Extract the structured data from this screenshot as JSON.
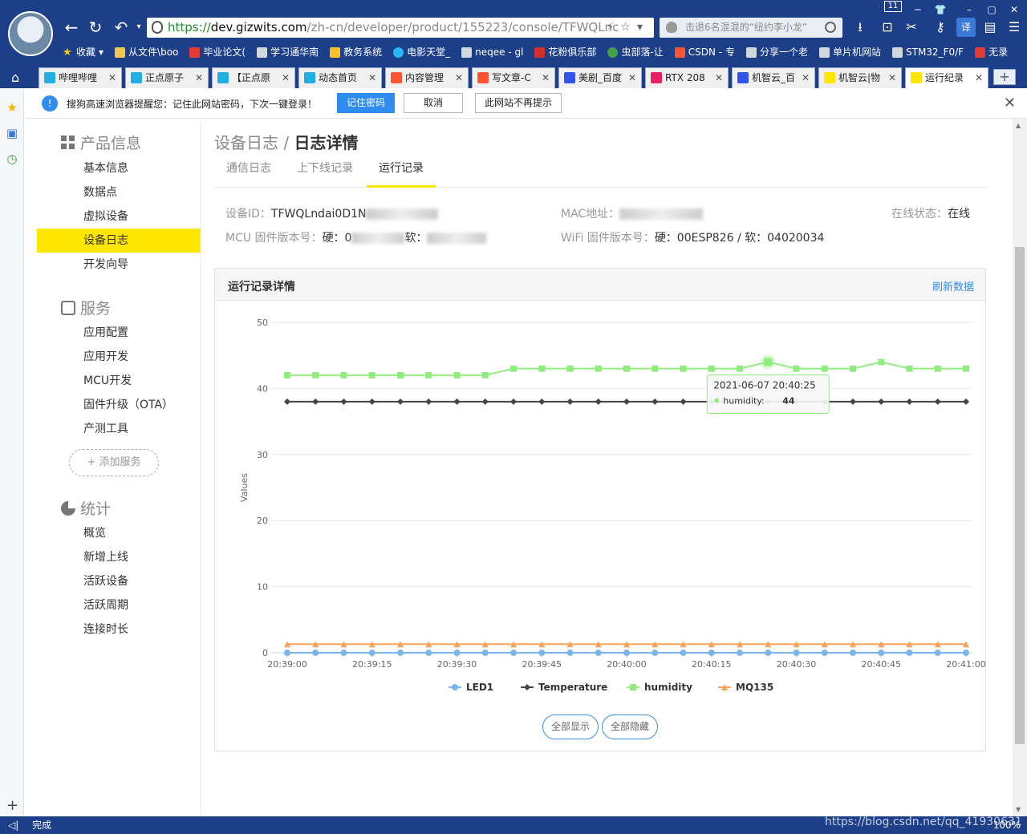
{
  "browser": {
    "url_scheme": "https://",
    "url_host": "dev.gizwits.com",
    "url_path": "/zh-cn/developer/product/155223/console/TFWQLnc",
    "search_text": "击退6名混混的“纽约李小龙”",
    "tab_counter": "11",
    "bookmarks": [
      "收藏",
      "从文件\\boo",
      "毕业论文(",
      "学习通华南",
      "教务系统",
      "电影天堂_",
      "neqee - gl",
      "花粉俱乐部",
      "虫部落-让",
      "CSDN - 专",
      "分享一个老",
      "单片机网站",
      "STM32_F0/F",
      "无录"
    ],
    "tabs": [
      "哔哩哔哩",
      "正点原子",
      "【正点原",
      "动态首页",
      "内容管理",
      "写文章-C",
      "美剧_百度",
      "RTX 208",
      "机智云_百",
      "机智云|物",
      "运行纪录"
    ]
  },
  "notify": {
    "message": "搜狗高速浏览器提醒您：记住此网站密码，下次一键登录！",
    "remember": "记住密码",
    "cancel": "取消",
    "never": "此网站不再提示"
  },
  "nav": {
    "group1": "产品信息",
    "items1": [
      "基本信息",
      "数据点",
      "虚拟设备",
      "设备日志",
      "开发向导"
    ],
    "group2": "服务",
    "items2": [
      "应用配置",
      "应用开发",
      "MCU开发",
      "固件升级（OTA）",
      "产测工具"
    ],
    "add_service": "+ 添加服务",
    "group3": "统计",
    "items3": [
      "概览",
      "新增上线",
      "活跃设备",
      "活跃周期",
      "连接时长"
    ]
  },
  "main": {
    "crumb_parent": "设备日志 / ",
    "crumb_current": "日志详情",
    "tabs": [
      "通信日志",
      "上下线记录",
      "运行记录"
    ],
    "device_id_label": "设备ID：",
    "device_id_value": "TFWQLndai0D1N",
    "mac_label": "MAC地址：",
    "status_label": "在线状态：",
    "status_value": "在线",
    "mcu_label": "MCU 固件版本号：",
    "mcu_hw": "硬：0",
    "mcu_sw": "软：",
    "wifi_label": "WiFi 固件版本号：",
    "wifi_value": "硬：00ESP826 / 软：04020034",
    "panel_title": "运行记录详情",
    "refresh": "刷新数据",
    "show_all": "全部显示",
    "hide_all": "全部隐藏"
  },
  "chart_data": {
    "type": "line",
    "ylabel": "Values",
    "ylim": [
      0,
      50
    ],
    "yticks": [
      0,
      10,
      20,
      30,
      40,
      50
    ],
    "xtick_labels": [
      "20:39:00",
      "20:39:15",
      "20:39:30",
      "20:39:45",
      "20:40:00",
      "20:40:15",
      "20:40:30",
      "20:40:45",
      "20:41:00"
    ],
    "x": [
      "20:39:00",
      "20:39:05",
      "20:39:10",
      "20:39:15",
      "20:39:20",
      "20:39:25",
      "20:39:30",
      "20:39:35",
      "20:39:40",
      "20:39:45",
      "20:39:50",
      "20:39:55",
      "20:40:00",
      "20:40:05",
      "20:40:10",
      "20:40:15",
      "20:40:20",
      "20:40:25",
      "20:40:30",
      "20:40:35",
      "20:40:40",
      "20:40:45",
      "20:40:50",
      "20:40:55",
      "20:41:00"
    ],
    "series": [
      {
        "name": "LED1",
        "color": "#7cb5ec",
        "marker": "circle",
        "values": [
          0,
          0,
          0,
          0,
          0,
          0,
          0,
          0,
          0,
          0,
          0,
          0,
          0,
          0,
          0,
          0,
          0,
          0,
          0,
          0,
          0,
          0,
          0,
          0,
          0
        ]
      },
      {
        "name": "Temperature",
        "color": "#434348",
        "marker": "diamond",
        "values": [
          38,
          38,
          38,
          38,
          38,
          38,
          38,
          38,
          38,
          38,
          38,
          38,
          38,
          38,
          38,
          38,
          38,
          38,
          38,
          38,
          38,
          38,
          38,
          38,
          38
        ]
      },
      {
        "name": "humidity",
        "color": "#90ed7d",
        "marker": "square",
        "values": [
          42,
          42,
          42,
          42,
          42,
          42,
          42,
          42,
          43,
          43,
          43,
          43,
          43,
          43,
          43,
          43,
          43,
          44,
          43,
          43,
          43,
          44,
          43,
          43,
          43
        ]
      },
      {
        "name": "MQ135",
        "color": "#f7a35c",
        "marker": "triangle",
        "values": [
          1.3,
          1.3,
          1.3,
          1.3,
          1.3,
          1.3,
          1.3,
          1.3,
          1.3,
          1.3,
          1.3,
          1.3,
          1.3,
          1.3,
          1.3,
          1.3,
          1.3,
          1.3,
          1.3,
          1.3,
          1.3,
          1.3,
          1.3,
          1.3,
          1.3
        ]
      }
    ],
    "tooltip": {
      "time": "2021-06-07 20:40:25",
      "series": "humidity",
      "label": "humidity: ",
      "value": "44"
    },
    "legend_position": "bottom-center",
    "grid": true
  },
  "status": {
    "done": "完成",
    "watermark": "https://blog.csdn.net/qq_41930631",
    "zoom": "100%"
  }
}
